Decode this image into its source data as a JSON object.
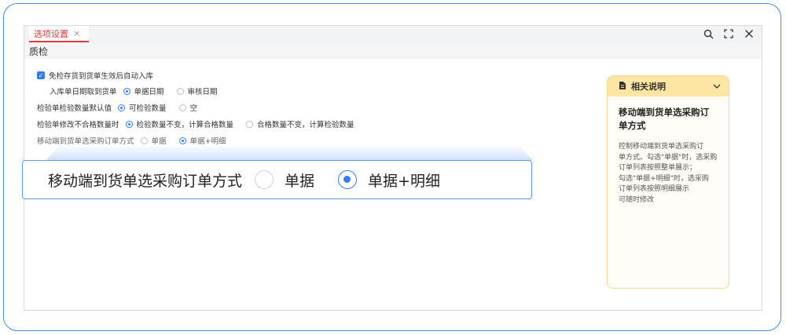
{
  "tab": {
    "label": "选项设置",
    "close": "×"
  },
  "window_tools": [
    "search-icon",
    "fullscreen-icon",
    "close-icon"
  ],
  "section": {
    "title": "质检"
  },
  "options": {
    "auto_stock": {
      "label": "免检存货到货单生效后自动入库",
      "checked": true
    },
    "stock_date": {
      "label": "入库单日期取到货单",
      "choices": [
        "单据日期",
        "审核日期"
      ],
      "selected": 0
    },
    "default_qty": {
      "label": "检验单检验数量默认值",
      "choices": [
        "可检验数量",
        "空"
      ],
      "selected": 0
    },
    "modify_fail": {
      "label": "检验单修改不合格数量时",
      "choices": [
        "检验数量不变，计算合格数量",
        "合格数量不变，计算检验数量"
      ],
      "selected": 0
    },
    "mobile_select": {
      "label": "移动端到货单选采购订单方式",
      "choices": [
        "单据",
        "单据+明细"
      ],
      "selected": 1
    }
  },
  "callout": {
    "label": "移动端到货单选采购订单方式",
    "choices": [
      "单据",
      "单据+明细"
    ],
    "selected": 1
  },
  "help": {
    "header": "相关说明",
    "title": "移动端到货单选采购订单方式",
    "lines": [
      "控制移动端到货单选采购订",
      "单方式。勾选\"单据\"时，选采购",
      "订单列表按照整单展示；",
      "勾选\"单据+明细\"时，选采购",
      "订单列表按照明细展示",
      "可随时修改"
    ]
  },
  "colors": {
    "accent": "#2f7cf6",
    "tab_active": "#e4393c",
    "help_header": "#fde6a4",
    "frame": "#3d8fe6"
  }
}
